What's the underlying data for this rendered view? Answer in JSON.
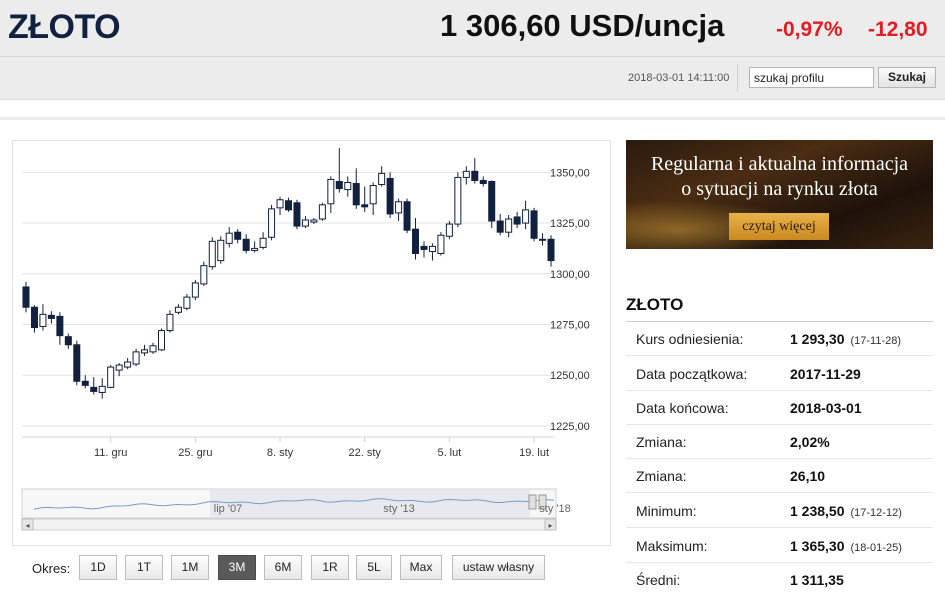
{
  "header": {
    "title": "ZŁOTO",
    "price": "1 306,60 USD/uncja",
    "change_pct": "-0,97%",
    "change_abs": "-12,80",
    "timestamp": "2018-03-01 14:11:00",
    "search_value": "szukaj profilu",
    "search_button": "Szukaj"
  },
  "colors": {
    "negative": "#e31b23",
    "candle_down": "#12213f",
    "candle_up": "#ffffff"
  },
  "chart_data": {
    "type": "candlestick",
    "y_axis_ticks": [
      "1350,00",
      "1325,00",
      "1300,00",
      "1275,00",
      "1250,00",
      "1225,00"
    ],
    "y_ticks_values": [
      1350,
      1325,
      1300,
      1275,
      1250,
      1225
    ],
    "ylim": [
      1222,
      1362
    ],
    "x_axis_ticks": [
      "11. gru",
      "25. gru",
      "8. sty",
      "22. sty",
      "5. lut",
      "19. lut"
    ],
    "x_ticks_index": [
      10,
      20,
      30,
      40,
      50,
      60
    ],
    "candles": [
      {
        "o": 1293.5,
        "h": 1296.0,
        "l": 1281.0,
        "c": 1283.5
      },
      {
        "o": 1283.5,
        "h": 1284.5,
        "l": 1271.0,
        "c": 1273.5
      },
      {
        "o": 1274.0,
        "h": 1285.0,
        "l": 1272.0,
        "c": 1280.0
      },
      {
        "o": 1279.5,
        "h": 1281.5,
        "l": 1275.5,
        "c": 1278.0
      },
      {
        "o": 1279.0,
        "h": 1281.0,
        "l": 1265.0,
        "c": 1269.5
      },
      {
        "o": 1269.0,
        "h": 1270.5,
        "l": 1263.0,
        "c": 1265.0
      },
      {
        "o": 1265.0,
        "h": 1267.0,
        "l": 1245.0,
        "c": 1247.0
      },
      {
        "o": 1247.0,
        "h": 1250.0,
        "l": 1243.5,
        "c": 1245.0
      },
      {
        "o": 1244.0,
        "h": 1249.0,
        "l": 1240.5,
        "c": 1242.0
      },
      {
        "o": 1241.5,
        "h": 1248.5,
        "l": 1238.5,
        "c": 1244.5
      },
      {
        "o": 1244.0,
        "h": 1255.0,
        "l": 1243.5,
        "c": 1254.0
      },
      {
        "o": 1252.5,
        "h": 1256.0,
        "l": 1249.5,
        "c": 1255.0
      },
      {
        "o": 1254.0,
        "h": 1258.5,
        "l": 1253.0,
        "c": 1256.5
      },
      {
        "o": 1255.5,
        "h": 1263.0,
        "l": 1254.5,
        "c": 1261.5
      },
      {
        "o": 1261.0,
        "h": 1265.0,
        "l": 1259.5,
        "c": 1262.5
      },
      {
        "o": 1261.5,
        "h": 1266.0,
        "l": 1260.5,
        "c": 1264.5
      },
      {
        "o": 1262.5,
        "h": 1273.0,
        "l": 1262.0,
        "c": 1272.0
      },
      {
        "o": 1272.0,
        "h": 1282.0,
        "l": 1271.0,
        "c": 1280.0
      },
      {
        "o": 1281.0,
        "h": 1285.0,
        "l": 1280.0,
        "c": 1283.5
      },
      {
        "o": 1283.0,
        "h": 1290.0,
        "l": 1282.0,
        "c": 1288.5
      },
      {
        "o": 1288.5,
        "h": 1297.0,
        "l": 1287.0,
        "c": 1295.5
      },
      {
        "o": 1295.0,
        "h": 1306.0,
        "l": 1294.0,
        "c": 1304.0
      },
      {
        "o": 1303.5,
        "h": 1318.0,
        "l": 1302.0,
        "c": 1316.0
      },
      {
        "o": 1306.5,
        "h": 1318.5,
        "l": 1305.0,
        "c": 1316.5
      },
      {
        "o": 1315.0,
        "h": 1323.0,
        "l": 1313.0,
        "c": 1320.0
      },
      {
        "o": 1320.5,
        "h": 1322.0,
        "l": 1315.0,
        "c": 1317.0
      },
      {
        "o": 1317.0,
        "h": 1319.5,
        "l": 1310.0,
        "c": 1311.5
      },
      {
        "o": 1311.5,
        "h": 1316.0,
        "l": 1310.5,
        "c": 1312.5
      },
      {
        "o": 1313.0,
        "h": 1320.5,
        "l": 1312.0,
        "c": 1317.5
      },
      {
        "o": 1318.0,
        "h": 1334.0,
        "l": 1316.5,
        "c": 1332.0
      },
      {
        "o": 1332.5,
        "h": 1338.0,
        "l": 1329.0,
        "c": 1336.5
      },
      {
        "o": 1336.0,
        "h": 1337.5,
        "l": 1330.5,
        "c": 1331.5
      },
      {
        "o": 1335.0,
        "h": 1336.5,
        "l": 1322.0,
        "c": 1323.5
      },
      {
        "o": 1323.5,
        "h": 1328.5,
        "l": 1322.5,
        "c": 1326.5
      },
      {
        "o": 1325.5,
        "h": 1327.5,
        "l": 1324.5,
        "c": 1326.5
      },
      {
        "o": 1327.0,
        "h": 1335.0,
        "l": 1326.0,
        "c": 1334.0
      },
      {
        "o": 1334.5,
        "h": 1348.0,
        "l": 1330.0,
        "c": 1346.5
      },
      {
        "o": 1345.5,
        "h": 1362.0,
        "l": 1340.0,
        "c": 1342.0
      },
      {
        "o": 1341.5,
        "h": 1348.0,
        "l": 1338.0,
        "c": 1345.0
      },
      {
        "o": 1344.5,
        "h": 1352.0,
        "l": 1332.0,
        "c": 1334.0
      },
      {
        "o": 1334.0,
        "h": 1343.0,
        "l": 1330.5,
        "c": 1333.0
      },
      {
        "o": 1334.5,
        "h": 1345.0,
        "l": 1329.0,
        "c": 1343.5
      },
      {
        "o": 1344.0,
        "h": 1353.0,
        "l": 1343.0,
        "c": 1349.5
      },
      {
        "o": 1347.0,
        "h": 1350.0,
        "l": 1327.5,
        "c": 1329.5
      },
      {
        "o": 1330.0,
        "h": 1337.0,
        "l": 1326.0,
        "c": 1335.5
      },
      {
        "o": 1335.5,
        "h": 1337.0,
        "l": 1320.0,
        "c": 1321.5
      },
      {
        "o": 1322.0,
        "h": 1327.5,
        "l": 1307.0,
        "c": 1310.0
      },
      {
        "o": 1313.5,
        "h": 1316.0,
        "l": 1308.0,
        "c": 1312.0
      },
      {
        "o": 1311.0,
        "h": 1315.0,
        "l": 1306.5,
        "c": 1313.5
      },
      {
        "o": 1310.0,
        "h": 1320.5,
        "l": 1309.0,
        "c": 1319.0
      },
      {
        "o": 1318.5,
        "h": 1326.0,
        "l": 1317.0,
        "c": 1324.5
      },
      {
        "o": 1324.5,
        "h": 1350.0,
        "l": 1323.0,
        "c": 1347.5
      },
      {
        "o": 1347.5,
        "h": 1353.0,
        "l": 1344.0,
        "c": 1350.5
      },
      {
        "o": 1350.5,
        "h": 1357.0,
        "l": 1344.5,
        "c": 1346.0
      },
      {
        "o": 1346.0,
        "h": 1348.0,
        "l": 1343.0,
        "c": 1344.5
      },
      {
        "o": 1345.5,
        "h": 1346.0,
        "l": 1322.5,
        "c": 1326.0
      },
      {
        "o": 1326.0,
        "h": 1329.5,
        "l": 1319.0,
        "c": 1320.5
      },
      {
        "o": 1320.5,
        "h": 1329.0,
        "l": 1318.0,
        "c": 1327.0
      },
      {
        "o": 1328.0,
        "h": 1330.5,
        "l": 1322.5,
        "c": 1324.5
      },
      {
        "o": 1325.0,
        "h": 1336.0,
        "l": 1322.0,
        "c": 1331.5
      },
      {
        "o": 1331.0,
        "h": 1332.5,
        "l": 1316.0,
        "c": 1317.5
      },
      {
        "o": 1317.0,
        "h": 1320.0,
        "l": 1314.0,
        "c": 1317.0
      },
      {
        "o": 1317.0,
        "h": 1319.0,
        "l": 1303.5,
        "c": 1306.5
      }
    ],
    "navigator": {
      "labels": [
        "lip '07",
        "sty '13",
        "sty '18"
      ]
    }
  },
  "period": {
    "label": "Okres:",
    "buttons": [
      {
        "label": "1D",
        "active": false
      },
      {
        "label": "1T",
        "active": false
      },
      {
        "label": "1M",
        "active": false
      },
      {
        "label": "3M",
        "active": true
      },
      {
        "label": "6M",
        "active": false
      },
      {
        "label": "1R",
        "active": false
      },
      {
        "label": "5L",
        "active": false
      },
      {
        "label": "Max",
        "active": false
      },
      {
        "label": "ustaw własny",
        "active": false
      }
    ]
  },
  "banner": {
    "line1": "Regularna i aktualna informacja",
    "line2": "o sytuacji na rynku złota",
    "button": "czytaj więcej"
  },
  "info": {
    "title": "ZŁOTO",
    "rows": [
      {
        "label": "Kurs odniesienia:",
        "value": "1 293,30",
        "date": "(17-11-28)"
      },
      {
        "label": "Data początkowa:",
        "value": "2017-11-29",
        "date": ""
      },
      {
        "label": "Data końcowa:",
        "value": "2018-03-01",
        "date": ""
      },
      {
        "label": "Zmiana:",
        "value": "2,02%",
        "date": ""
      },
      {
        "label": "Zmiana:",
        "value": "26,10",
        "date": ""
      },
      {
        "label": "Minimum:",
        "value": "1 238,50",
        "date": "(17-12-12)"
      },
      {
        "label": "Maksimum:",
        "value": "1 365,30",
        "date": "(18-01-25)"
      },
      {
        "label": "Średni:",
        "value": "1 311,35",
        "date": ""
      }
    ]
  }
}
